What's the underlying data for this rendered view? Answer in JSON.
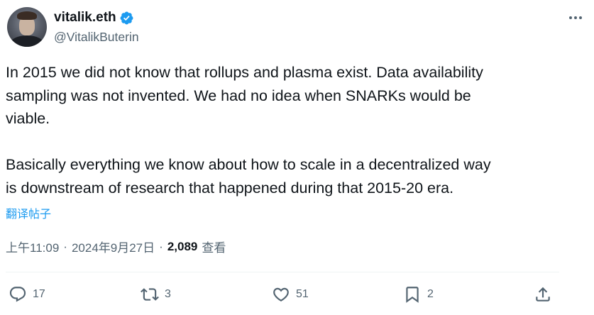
{
  "author": {
    "display_name": "vitalik.eth",
    "handle": "@VitalikButerin",
    "verified_icon": "verified-badge-icon",
    "avatar_icon": "user-avatar"
  },
  "tweet": {
    "text": "In 2015 we did not know that rollups and plasma exist. Data availability\nsampling was not invented. We had no idea when SNARKs would be\nviable.\n\nBasically everything we know about how to scale in a decentralized way\nis downstream of research that happened during that 2015-20 era.",
    "translate_label": "翻译帖子"
  },
  "meta": {
    "time": "上午11:09",
    "separator": "·",
    "date": "2024年9月27日",
    "views_count": "2,089",
    "views_label": "查看"
  },
  "actions": {
    "reply_count": "17",
    "retweet_count": "3",
    "like_count": "51",
    "bookmark_count": "2"
  },
  "colors": {
    "accent": "#1d9bf0",
    "secondary_text": "#536471",
    "primary_text": "#0f1419"
  }
}
